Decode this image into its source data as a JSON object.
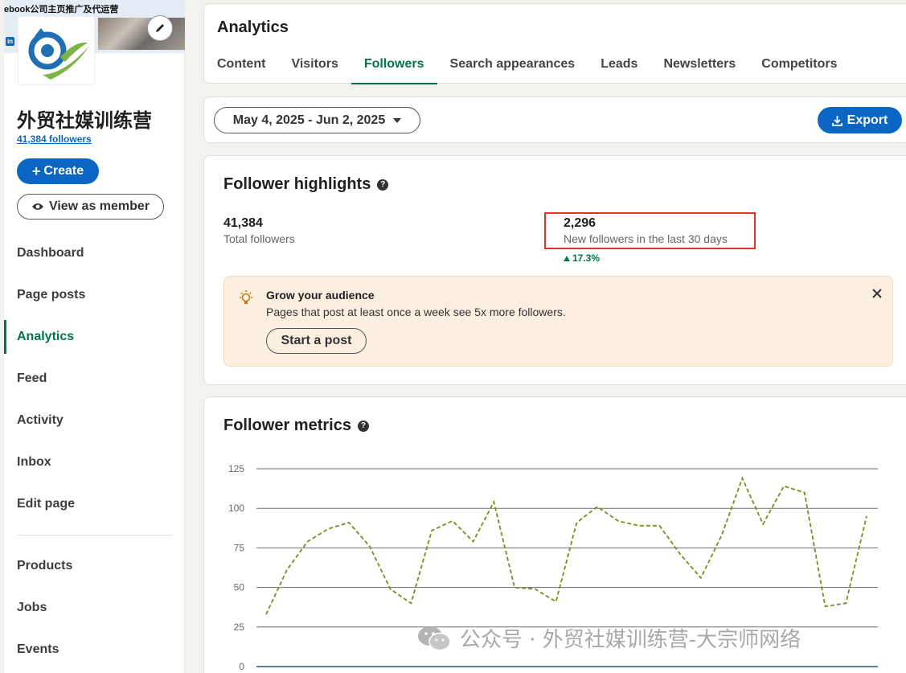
{
  "sidebar": {
    "cover_text": "ebook公司主页推广及代运营",
    "cover_badge": "in",
    "company_name": "外贸社媒训练营",
    "followers_link": "41,384 followers",
    "create_label": "Create",
    "view_member_label": "View as member",
    "nav_items": [
      {
        "label": "Dashboard"
      },
      {
        "label": "Page posts"
      },
      {
        "label": "Analytics"
      },
      {
        "label": "Feed"
      },
      {
        "label": "Activity"
      },
      {
        "label": "Inbox"
      },
      {
        "label": "Edit page"
      }
    ],
    "nav_items_lower": [
      {
        "label": "Products"
      },
      {
        "label": "Jobs"
      },
      {
        "label": "Events"
      }
    ]
  },
  "header": {
    "title": "Analytics",
    "tabs": [
      {
        "label": "Content"
      },
      {
        "label": "Visitors"
      },
      {
        "label": "Followers"
      },
      {
        "label": "Search appearances"
      },
      {
        "label": "Leads"
      },
      {
        "label": "Newsletters"
      },
      {
        "label": "Competitors"
      }
    ],
    "active_tab": "Followers"
  },
  "filter": {
    "date_range": "May 4, 2025 - Jun 2, 2025",
    "export_label": "Export"
  },
  "highlights": {
    "title": "Follower highlights",
    "total_value": "41,384",
    "total_label": "Total followers",
    "new_value": "2,296",
    "new_label": "New followers in the last 30 days",
    "new_change": "17.3%",
    "banner_title": "Grow your audience",
    "banner_text": "Pages that post at least once a week see 5x more followers.",
    "banner_button": "Start a post"
  },
  "metrics": {
    "title": "Follower metrics"
  },
  "watermark": "公众号 · 外贸社媒训练营-大宗师网络",
  "colors": {
    "accent_blue": "#0a66c2",
    "accent_green": "#01754f",
    "line_color": "#7c8c1f",
    "highlight_red": "#e0312b"
  },
  "chart_data": {
    "type": "line",
    "title": "",
    "xlabel": "",
    "ylabel": "",
    "ylim": [
      0,
      125
    ],
    "yticks": [
      "0",
      "25",
      "50",
      "75",
      "100",
      "125"
    ],
    "grid": true,
    "series": [
      {
        "style": "dashed",
        "values": [
          33,
          61,
          79,
          87,
          91,
          76,
          49,
          40,
          86,
          92,
          79,
          104,
          50,
          49,
          41,
          91,
          101,
          92,
          89,
          89,
          71,
          56,
          83,
          119,
          90,
          114,
          110,
          38,
          40,
          95
        ]
      }
    ]
  }
}
